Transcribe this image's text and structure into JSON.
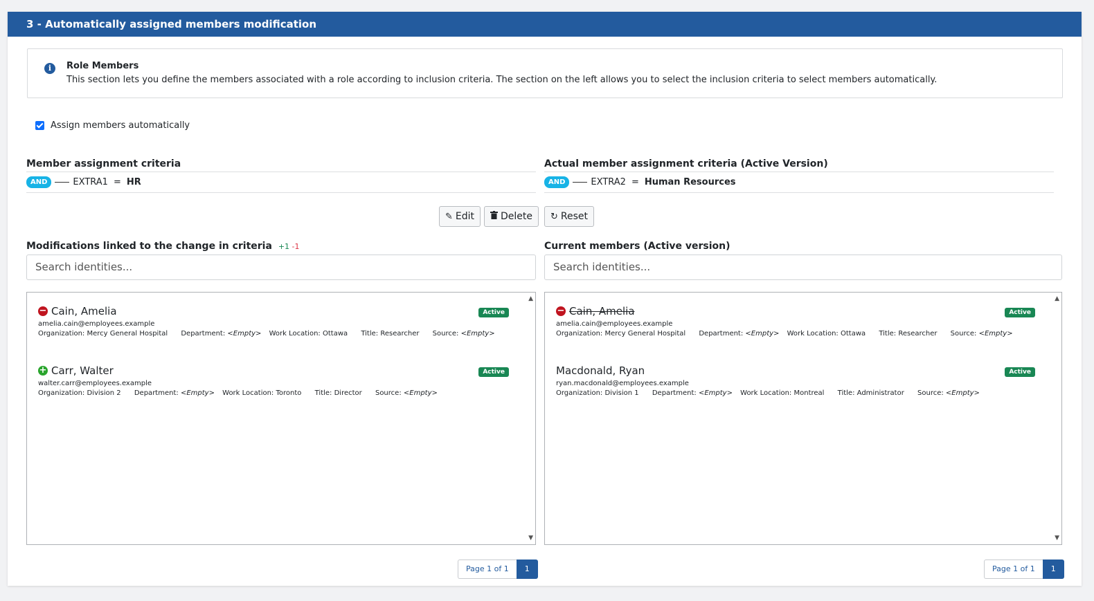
{
  "header": {
    "title": "3 - Automatically assigned members modification"
  },
  "info": {
    "icon": "info-icon",
    "title": "Role Members",
    "text": "This section lets you define the members associated with a role according to inclusion criteria. The section on the left allows you to select the inclusion criteria to select members automatically."
  },
  "auto_assign": {
    "label": "Assign members automatically",
    "checked": true
  },
  "left": {
    "criteria_title": "Member assignment criteria",
    "criteria": {
      "operator": "AND",
      "field": "EXTRA1",
      "eq": "=",
      "value": "HR"
    },
    "modifications_title": "Modifications linked to the change in criteria",
    "plus": "+1",
    "minus": "-1",
    "search_placeholder": "Search identities...",
    "members": [
      {
        "change": "removed",
        "name": "Cain, Amelia",
        "status": "Active",
        "email": "amelia.cain@employees.example",
        "org_label": "Organization:",
        "org": "Mercy General Hospital",
        "dept_label": "Department:",
        "dept": "<Empty>",
        "loc_label": "Work Location:",
        "loc": "Ottawa",
        "title_label": "Title:",
        "title": "Researcher",
        "source_label": "Source:",
        "source": "<Empty>"
      },
      {
        "change": "added",
        "name": "Carr, Walter",
        "status": "Active",
        "email": "walter.carr@employees.example",
        "org_label": "Organization:",
        "org": "Division 2",
        "dept_label": "Department:",
        "dept": "<Empty>",
        "loc_label": "Work Location:",
        "loc": "Toronto",
        "title_label": "Title:",
        "title": "Director",
        "source_label": "Source:",
        "source": "<Empty>"
      }
    ],
    "pager": {
      "label": "Page 1 of 1",
      "current": "1"
    }
  },
  "right": {
    "criteria_title": "Actual member assignment criteria (Active Version)",
    "criteria": {
      "operator": "AND",
      "field": "EXTRA2",
      "eq": "=",
      "value": "Human Resources"
    },
    "members_title": "Current members (Active version)",
    "search_placeholder": "Search identities...",
    "members": [
      {
        "change": "removed",
        "name": "Cain, Amelia",
        "status": "Active",
        "email": "amelia.cain@employees.example",
        "org_label": "Organization:",
        "org": "Mercy General Hospital",
        "dept_label": "Department:",
        "dept": "<Empty>",
        "loc_label": "Work Location:",
        "loc": "Ottawa",
        "title_label": "Title:",
        "title": "Researcher",
        "source_label": "Source:",
        "source": "<Empty>"
      },
      {
        "change": "none",
        "name": "Macdonald, Ryan",
        "status": "Active",
        "email": "ryan.macdonald@employees.example",
        "org_label": "Organization:",
        "org": "Division 1",
        "dept_label": "Department:",
        "dept": "<Empty>",
        "loc_label": "Work Location:",
        "loc": "Montreal",
        "title_label": "Title:",
        "title": "Administrator",
        "source_label": "Source:",
        "source": "<Empty>"
      }
    ],
    "pager": {
      "label": "Page 1 of 1",
      "current": "1"
    }
  },
  "buttons": {
    "edit": "Edit",
    "delete": "Delete",
    "reset": "Reset"
  },
  "scroll": {
    "up": "▲",
    "down": "▼"
  }
}
